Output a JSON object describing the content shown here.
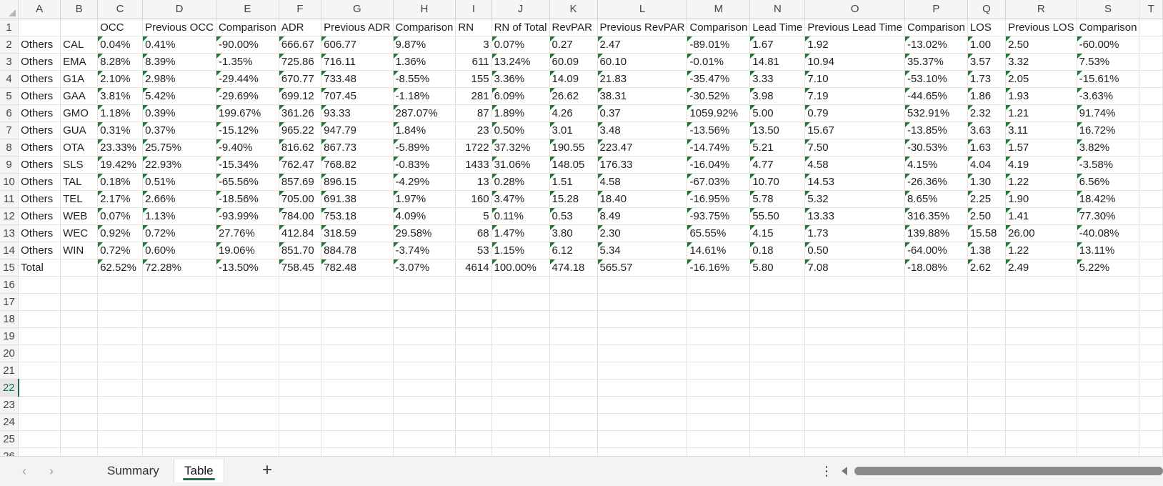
{
  "columns": [
    "A",
    "B",
    "C",
    "D",
    "E",
    "F",
    "G",
    "H",
    "I",
    "J",
    "K",
    "L",
    "M",
    "N",
    "O",
    "P",
    "Q",
    "R",
    "S",
    "T"
  ],
  "active_row": 22,
  "headers": [
    "",
    "",
    "OCC",
    "Previous OCC",
    "Comparison",
    "ADR",
    "Previous ADR",
    "Comparison",
    "RN",
    "RN of Total",
    "RevPAR",
    "Previous RevPAR",
    "Comparison",
    "Lead Time",
    "Previous Lead Time",
    "Comparison",
    "LOS",
    "Previous LOS",
    "Comparison"
  ],
  "rows": [
    [
      "Others",
      "CAL",
      "0.04%",
      "0.41%",
      "-90.00%",
      "666.67",
      "606.77",
      "9.87%",
      "3",
      "0.07%",
      "0.27",
      "2.47",
      "-89.01%",
      "1.67",
      "1.92",
      "-13.02%",
      "1.00",
      "2.50",
      "-60.00%"
    ],
    [
      "Others",
      "EMA",
      "8.28%",
      "8.39%",
      "-1.35%",
      "725.86",
      "716.11",
      "1.36%",
      "611",
      "13.24%",
      "60.09",
      "60.10",
      "-0.01%",
      "14.81",
      "10.94",
      "35.37%",
      "3.57",
      "3.32",
      "7.53%"
    ],
    [
      "Others",
      "G1A",
      "2.10%",
      "2.98%",
      "-29.44%",
      "670.77",
      "733.48",
      "-8.55%",
      "155",
      "3.36%",
      "14.09",
      "21.83",
      "-35.47%",
      "3.33",
      "7.10",
      "-53.10%",
      "1.73",
      "2.05",
      "-15.61%"
    ],
    [
      "Others",
      "GAA",
      "3.81%",
      "5.42%",
      "-29.69%",
      "699.12",
      "707.45",
      "-1.18%",
      "281",
      "6.09%",
      "26.62",
      "38.31",
      "-30.52%",
      "3.98",
      "7.19",
      "-44.65%",
      "1.86",
      "1.93",
      "-3.63%"
    ],
    [
      "Others",
      "GMO",
      "1.18%",
      "0.39%",
      "199.67%",
      "361.26",
      "93.33",
      "287.07%",
      "87",
      "1.89%",
      "4.26",
      "0.37",
      "1059.92%",
      "5.00",
      "0.79",
      "532.91%",
      "2.32",
      "1.21",
      "91.74%"
    ],
    [
      "Others",
      "GUA",
      "0.31%",
      "0.37%",
      "-15.12%",
      "965.22",
      "947.79",
      "1.84%",
      "23",
      "0.50%",
      "3.01",
      "3.48",
      "-13.56%",
      "13.50",
      "15.67",
      "-13.85%",
      "3.63",
      "3.11",
      "16.72%"
    ],
    [
      "Others",
      "OTA",
      "23.33%",
      "25.75%",
      "-9.40%",
      "816.62",
      "867.73",
      "-5.89%",
      "1722",
      "37.32%",
      "190.55",
      "223.47",
      "-14.74%",
      "5.21",
      "7.50",
      "-30.53%",
      "1.63",
      "1.57",
      "3.82%"
    ],
    [
      "Others",
      "SLS",
      "19.42%",
      "22.93%",
      "-15.34%",
      "762.47",
      "768.82",
      "-0.83%",
      "1433",
      "31.06%",
      "148.05",
      "176.33",
      "-16.04%",
      "4.77",
      "4.58",
      "4.15%",
      "4.04",
      "4.19",
      "-3.58%"
    ],
    [
      "Others",
      "TAL",
      "0.18%",
      "0.51%",
      "-65.56%",
      "857.69",
      "896.15",
      "-4.29%",
      "13",
      "0.28%",
      "1.51",
      "4.58",
      "-67.03%",
      "10.70",
      "14.53",
      "-26.36%",
      "1.30",
      "1.22",
      "6.56%"
    ],
    [
      "Others",
      "TEL",
      "2.17%",
      "2.66%",
      "-18.56%",
      "705.00",
      "691.38",
      "1.97%",
      "160",
      "3.47%",
      "15.28",
      "18.40",
      "-16.95%",
      "5.78",
      "5.32",
      "8.65%",
      "2.25",
      "1.90",
      "18.42%"
    ],
    [
      "Others",
      "WEB",
      "0.07%",
      "1.13%",
      "-93.99%",
      "784.00",
      "753.18",
      "4.09%",
      "5",
      "0.11%",
      "0.53",
      "8.49",
      "-93.75%",
      "55.50",
      "13.33",
      "316.35%",
      "2.50",
      "1.41",
      "77.30%"
    ],
    [
      "Others",
      "WEC",
      "0.92%",
      "0.72%",
      "27.76%",
      "412.84",
      "318.59",
      "29.58%",
      "68",
      "1.47%",
      "3.80",
      "2.30",
      "65.55%",
      "4.15",
      "1.73",
      "139.88%",
      "15.58",
      "26.00",
      "-40.08%"
    ],
    [
      "Others",
      "WIN",
      "0.72%",
      "0.60%",
      "19.06%",
      "851.70",
      "884.78",
      "-3.74%",
      "53",
      "1.15%",
      "6.12",
      "5.34",
      "14.61%",
      "0.18",
      "0.50",
      "-64.00%",
      "1.38",
      "1.22",
      "13.11%"
    ],
    [
      "Total",
      "",
      "62.52%",
      "72.28%",
      "-13.50%",
      "758.45",
      "782.48",
      "-3.07%",
      "4614",
      "100.00%",
      "474.18",
      "565.57",
      "-16.16%",
      "5.80",
      "7.08",
      "-18.08%",
      "2.62",
      "2.49",
      "5.22%"
    ]
  ],
  "tabs": [
    {
      "label": "Summary",
      "active": false
    },
    {
      "label": "Table",
      "active": true
    }
  ],
  "icons": {
    "prev_sheet": "chevron-left-icon",
    "next_sheet": "chevron-right-icon",
    "add_sheet": "plus-icon",
    "more": "more-vertical-icon"
  },
  "colors": {
    "accent": "#1e7145",
    "error_indicator": "#1e7b34"
  }
}
